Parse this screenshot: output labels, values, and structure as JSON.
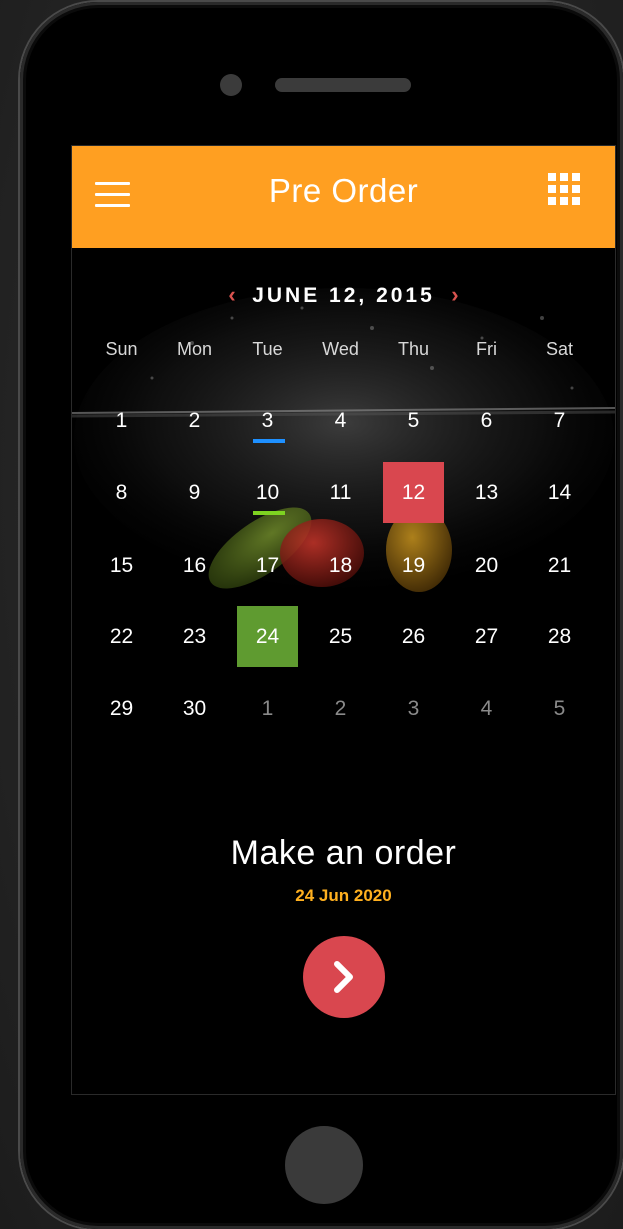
{
  "app": {
    "title": "Pre Order",
    "menu_icon": "hamburger-menu-icon",
    "grid_icon": "grid-apps-icon",
    "header_color": "#ff9f21"
  },
  "calendar": {
    "month_label": "JUNE 12, 2015",
    "prev_symbol": "‹",
    "next_symbol": "›",
    "weekdays": [
      "Sun",
      "Mon",
      "Tue",
      "Wed",
      "Thu",
      "Fri",
      "Sat"
    ],
    "weeks": [
      [
        {
          "d": "1"
        },
        {
          "d": "2"
        },
        {
          "d": "3",
          "mark": "blue"
        },
        {
          "d": "4"
        },
        {
          "d": "5"
        },
        {
          "d": "6"
        },
        {
          "d": "7"
        }
      ],
      [
        {
          "d": "8"
        },
        {
          "d": "9"
        },
        {
          "d": "10",
          "mark": "green"
        },
        {
          "d": "11"
        },
        {
          "d": "12",
          "selected": "red"
        },
        {
          "d": "13"
        },
        {
          "d": "14"
        }
      ],
      [
        {
          "d": "15"
        },
        {
          "d": "16"
        },
        {
          "d": "17"
        },
        {
          "d": "18"
        },
        {
          "d": "19"
        },
        {
          "d": "20"
        },
        {
          "d": "21"
        }
      ],
      [
        {
          "d": "22"
        },
        {
          "d": "23"
        },
        {
          "d": "24",
          "selected": "green"
        },
        {
          "d": "25"
        },
        {
          "d": "26"
        },
        {
          "d": "27"
        },
        {
          "d": "28"
        }
      ],
      [
        {
          "d": "29"
        },
        {
          "d": "30"
        },
        {
          "d": "1",
          "muted": true
        },
        {
          "d": "2",
          "muted": true
        },
        {
          "d": "3",
          "muted": true
        },
        {
          "d": "4",
          "muted": true
        },
        {
          "d": "5",
          "muted": true
        }
      ]
    ],
    "colors": {
      "blue": "#1e90ff",
      "green": "#7ed321",
      "red": "#d9474f",
      "selected_green": "#5f9b30"
    }
  },
  "order": {
    "title": "Make an order",
    "date": "24 Jun 2020",
    "button_icon": "chevron-right-icon"
  }
}
